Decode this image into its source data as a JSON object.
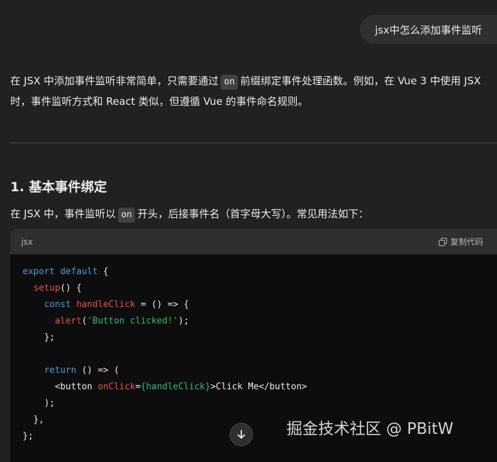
{
  "user_message": "jsx中怎么添加事件监听",
  "intro": {
    "part1": "在 JSX 中添加事件监听非常简单，只需要通过",
    "code": "on",
    "part2": "前缀绑定事件处理函数。例如，在 Vue 3 中使用 JSX 时，事件监听方式和 React 类似，但遵循 Vue 的事件命名规则。"
  },
  "section": {
    "heading": "1. 基本事件绑定",
    "text1": "在 JSX 中，事件监听以",
    "code": "on",
    "text2": "开头，后接事件名（首字母大写）。常见用法如下："
  },
  "code_block": {
    "language": "jsx",
    "copy_label": "复制代码",
    "lines": {
      "l1_kw": "export default",
      "l1_rest": " {",
      "l2_fn": "setup",
      "l2_rest": "() {",
      "l3_kw": "const",
      "l3_fn": "handleClick",
      "l3_rest": " = () => {",
      "l4_fn": "alert",
      "l4_p1": "(",
      "l4_str": "'Button clicked!'",
      "l4_p2": ");",
      "l5": "};",
      "l7_kw": "return",
      "l7_rest": " () => (",
      "l8_tag": "<button ",
      "l8_attr": "onClick",
      "l8_eq": "=",
      "l8_expr": "{handleClick}",
      "l8_rest": ">Click Me</button>",
      "l9": ");",
      "l10": "},",
      "l11": "};"
    }
  },
  "scroll_icon": "arrow-down-icon",
  "watermark": "掘金技术社区 @ PBitW"
}
